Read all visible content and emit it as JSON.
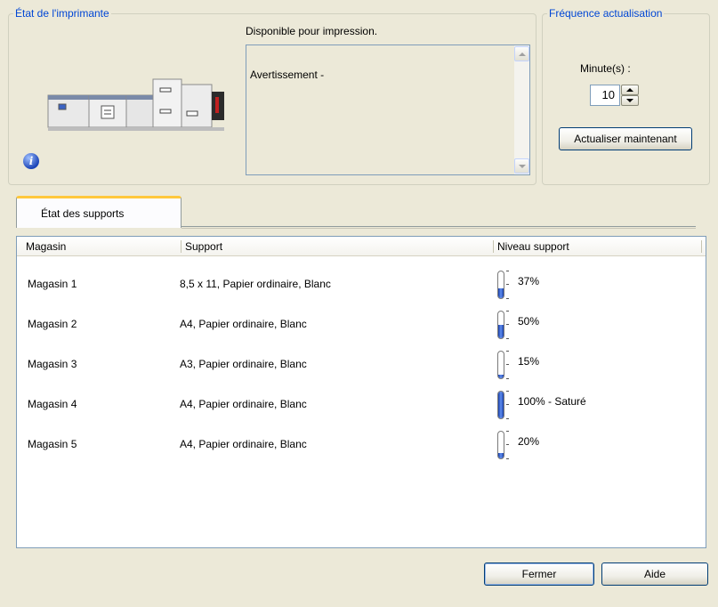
{
  "printer_status": {
    "legend": "État de l'imprimante",
    "availability": "Disponible pour impression.",
    "warning": "Avertissement -"
  },
  "refresh": {
    "legend": "Fréquence actualisation",
    "minutes_label": "Minute(s) :",
    "minutes_value": "10",
    "refresh_now_label": "Actualiser maintenant"
  },
  "tabs": [
    {
      "label": "État des supports",
      "active": true
    }
  ],
  "table": {
    "headers": [
      "Magasin",
      "Support",
      "Niveau support"
    ],
    "rows": [
      {
        "tray": "Magasin 1",
        "media": "8,5 x 11, Papier ordinaire, Blanc",
        "level_text": "37%",
        "level_fraction": 0.37
      },
      {
        "tray": "Magasin 2",
        "media": "A4, Papier ordinaire, Blanc",
        "level_text": "50%",
        "level_fraction": 0.5
      },
      {
        "tray": "Magasin 3",
        "media": "A3, Papier ordinaire, Blanc",
        "level_text": "15%",
        "level_fraction": 0.15
      },
      {
        "tray": "Magasin 4",
        "media": "A4, Papier ordinaire, Blanc",
        "level_text": "100% - Saturé",
        "level_fraction": 1.0
      },
      {
        "tray": "Magasin 5",
        "media": "A4, Papier ordinaire, Blanc",
        "level_text": "20%",
        "level_fraction": 0.2
      }
    ]
  },
  "buttons": {
    "close": "Fermer",
    "help": "Aide"
  },
  "icons": {
    "info": "info-icon",
    "printer": "printer-icon",
    "gauge": "level-gauge-icon"
  },
  "colors": {
    "legend_text": "#0046d5",
    "window_bg": "#ece9d8",
    "tab_accent": "#ffc83c",
    "gauge_fill": "#1a3fa6"
  }
}
